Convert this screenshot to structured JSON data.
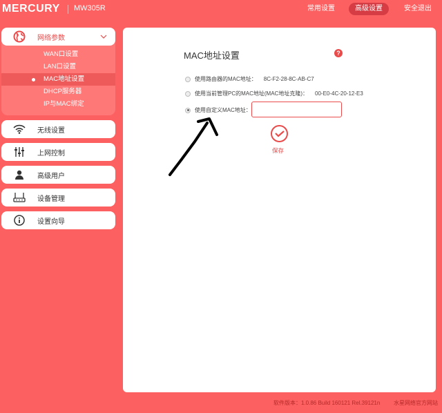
{
  "header": {
    "brand": "MERCURY",
    "model": "MW305R",
    "nav": [
      {
        "label": "常用设置",
        "active": false
      },
      {
        "label": "高级设置",
        "active": true
      },
      {
        "label": "安全退出",
        "active": false
      }
    ]
  },
  "sidebar": {
    "network": {
      "label": "网络参数",
      "icon": "globe-icon",
      "subitems": [
        "WAN口设置",
        "LAN口设置",
        "MAC地址设置",
        "DHCP服务器",
        "IP与MAC绑定"
      ],
      "active": "MAC地址设置"
    },
    "items": [
      {
        "label": "无线设置",
        "icon": "wifi-icon"
      },
      {
        "label": "上网控制",
        "icon": "sliders-icon"
      },
      {
        "label": "高级用户",
        "icon": "user-icon"
      },
      {
        "label": "设备管理",
        "icon": "router-icon"
      },
      {
        "label": "设置向导",
        "icon": "info-icon"
      }
    ]
  },
  "main": {
    "title": "MAC地址设置",
    "help": "?",
    "options": [
      {
        "label": "使用路由器的MAC地址：",
        "value": "8C-F2-28-8C-AB-C7",
        "selected": false
      },
      {
        "label": "使用当前管理PC的MAC地址(MAC地址克隆)：",
        "value": "00-E0-4C-20-12-E3",
        "selected": false
      },
      {
        "label": "使用自定义MAC地址：",
        "value": "",
        "selected": true
      }
    ],
    "custom_mac": "",
    "save_label": "保存"
  },
  "footer": {
    "version": "软件版本：1.0.86 Build 160121 Rel.39121n",
    "site": "水星网络官方网站"
  },
  "colors": {
    "accent": "#fd6060",
    "active": "#d63c44",
    "red": "#e94b4b"
  }
}
